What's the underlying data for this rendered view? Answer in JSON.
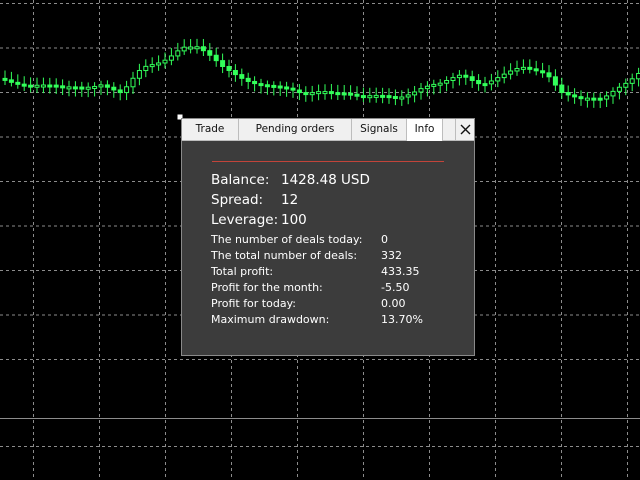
{
  "tabs": [
    {
      "label": "Trade",
      "active": false
    },
    {
      "label": "Pending orders",
      "active": false
    },
    {
      "label": "Signals",
      "active": false
    },
    {
      "label": "Info",
      "active": true
    }
  ],
  "close_icon": "close-icon",
  "info": {
    "balance_label": "Balance:",
    "balance_value": "1428.48",
    "balance_currency": "USD",
    "spread_label": "Spread:",
    "spread_value": "12",
    "leverage_label": "Leverage:",
    "leverage_value": "100",
    "stats": [
      {
        "label": "The number of deals today:",
        "value": "0"
      },
      {
        "label": "The total number of deals:",
        "value": "332"
      },
      {
        "label": "Total profit:",
        "value": "433.35"
      },
      {
        "label": "Profit for the month:",
        "value": "-5.50"
      },
      {
        "label": "Profit for today:",
        "value": "0.00"
      },
      {
        "label": "Maximum drawdown:",
        "value": "13.70%"
      }
    ]
  },
  "colors": {
    "background": "#000000",
    "grid": "#8c8c8c",
    "candle": "#32ff5a",
    "panel": "#3c3c3c",
    "separator": "#c2443a"
  }
}
